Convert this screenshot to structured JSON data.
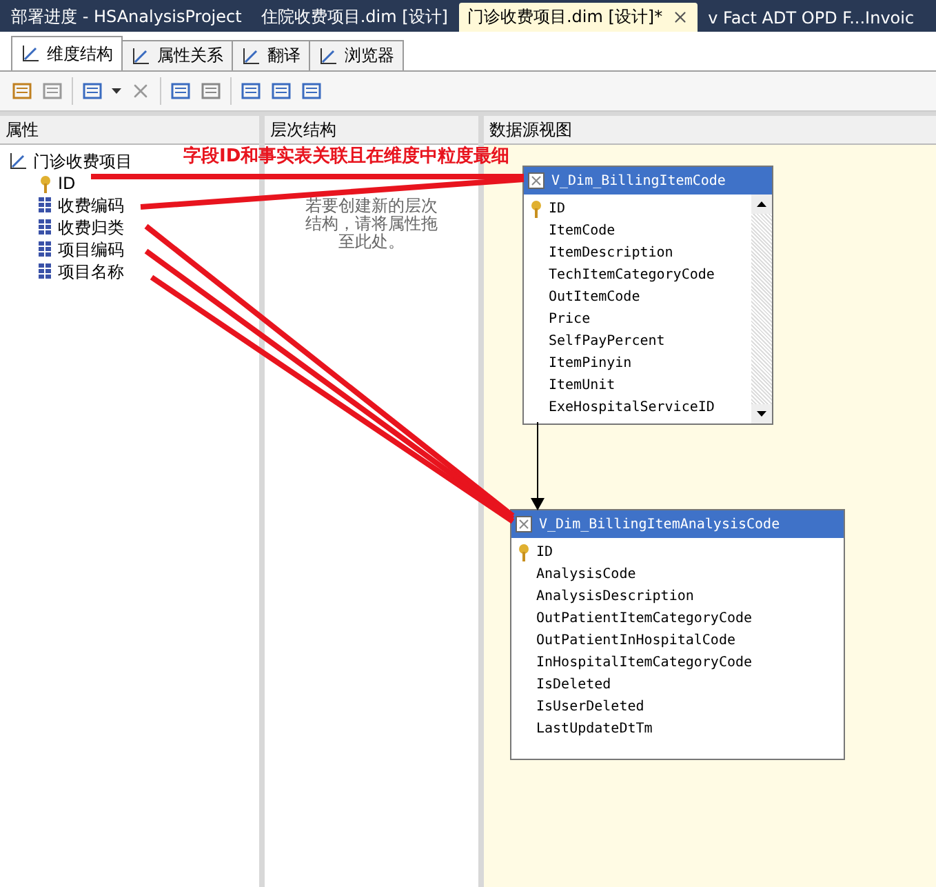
{
  "document_tabs": [
    {
      "label": "部署进度 - HSAnalysisProject",
      "selected": false
    },
    {
      "label": "住院收费项目.dim [设计]",
      "selected": false
    },
    {
      "label": "门诊收费项目.dim [设计]*",
      "selected": true
    },
    {
      "label": "v Fact ADT OPD F...Invoic",
      "selected": false
    }
  ],
  "designer_tabs": [
    {
      "label": "维度结构",
      "selected": true
    },
    {
      "label": "属性关系",
      "selected": false
    },
    {
      "label": "翻译",
      "selected": false
    },
    {
      "label": "浏览器",
      "selected": false
    }
  ],
  "attributes_pane": {
    "title": "属性",
    "dimension": "门诊收费项目",
    "attributes": [
      {
        "name": "ID",
        "kind": "key"
      },
      {
        "name": "收费编码",
        "kind": "attribute"
      },
      {
        "name": "收费归类",
        "kind": "attribute"
      },
      {
        "name": "项目编码",
        "kind": "attribute"
      },
      {
        "name": "项目名称",
        "kind": "attribute"
      }
    ]
  },
  "hierarchies_pane": {
    "title": "层次结构",
    "hint": "若要创建新的层次结构，请将属性拖至此处。"
  },
  "data_source_view": {
    "title": "数据源视图",
    "tables": [
      {
        "name": "V_Dim_BillingItemCode",
        "scrollable": true,
        "columns": [
          {
            "name": "ID",
            "key": true
          },
          {
            "name": "ItemCode",
            "key": false
          },
          {
            "name": "ItemDescription",
            "key": false
          },
          {
            "name": "TechItemCategoryCode",
            "key": false
          },
          {
            "name": "OutItemCode",
            "key": false
          },
          {
            "name": "Price",
            "key": false
          },
          {
            "name": "SelfPayPercent",
            "key": false
          },
          {
            "name": "ItemPinyin",
            "key": false
          },
          {
            "name": "ItemUnit",
            "key": false
          },
          {
            "name": "ExeHospitalServiceID",
            "key": false
          }
        ]
      },
      {
        "name": "V_Dim_BillingItemAnalysisCode",
        "scrollable": false,
        "columns": [
          {
            "name": "ID",
            "key": true
          },
          {
            "name": "AnalysisCode",
            "key": false
          },
          {
            "name": "AnalysisDescription",
            "key": false
          },
          {
            "name": "OutPatientItemCategoryCode",
            "key": false
          },
          {
            "name": "OutPatientInHospitalCode",
            "key": false
          },
          {
            "name": "InHospitalItemCategoryCode",
            "key": false
          },
          {
            "name": "IsDeleted",
            "key": false
          },
          {
            "name": "IsUserDeleted",
            "key": false
          },
          {
            "name": "LastUpdateDtTm",
            "key": false
          }
        ]
      }
    ]
  },
  "annotation": {
    "text": "字段ID和事实表关联且在维度中粒度最细"
  }
}
